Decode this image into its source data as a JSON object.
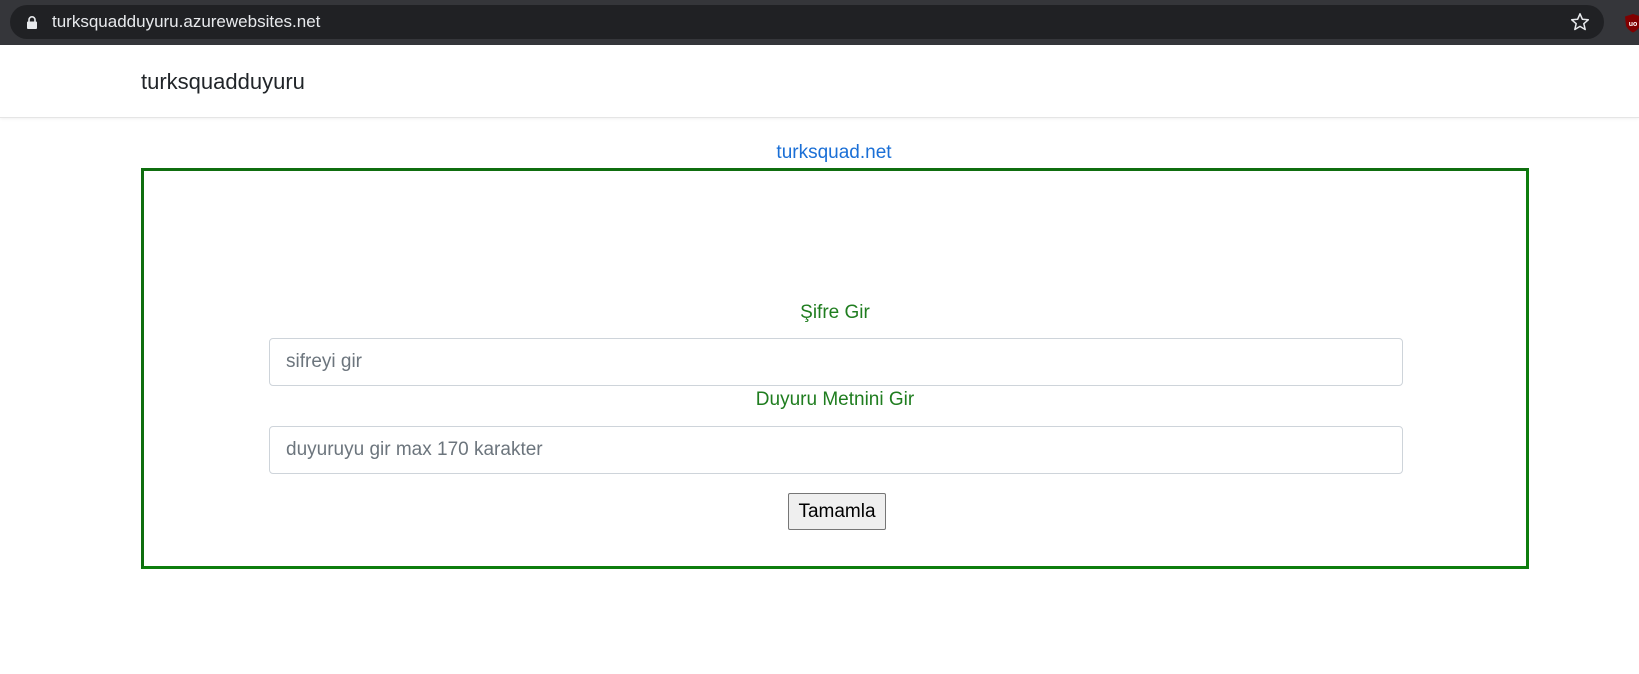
{
  "browser": {
    "url": "turksquadduyuru.azurewebsites.net",
    "icons": [
      "lock-icon",
      "star-icon",
      "ublock-extension-icon"
    ]
  },
  "navbar": {
    "brand": "turksquadduyuru"
  },
  "main": {
    "site_link": "turksquad.net",
    "form": {
      "password_label": "Şifre Gir",
      "password_placeholder": "sifreyi gir",
      "password_value": "",
      "announcement_label": "Duyuru Metnini Gir",
      "announcement_placeholder": "duyuruyu gir max 170 karakter",
      "announcement_value": "",
      "submit_label": "Tamamla"
    }
  },
  "colors": {
    "chrome": "#35363a",
    "omnibox": "#202124",
    "link": "#1a6fd6",
    "label_green": "#1f7d1f",
    "border_green": "#0f6e0f"
  }
}
